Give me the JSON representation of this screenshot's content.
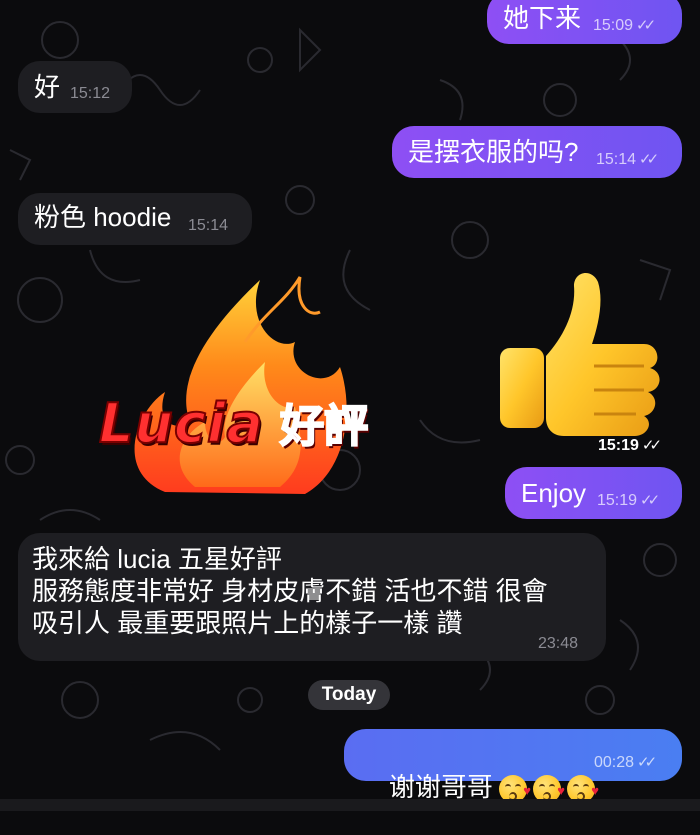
{
  "messages": [
    {
      "text": "她下来",
      "time": "15:09"
    },
    {
      "text": "好",
      "time": "15:12"
    },
    {
      "text": "是摆衣服的吗?",
      "time": "15:14"
    },
    {
      "text": "粉色 hoodie",
      "time": "15:14"
    },
    {
      "text": "15:19"
    },
    {
      "text": "Enjoy",
      "time": "15:19"
    },
    {
      "text": "我來給 lucia 五星好評\n服務態度非常好 身材皮膚不錯 活也不錯 很會\n吸引人 最重要跟照片上的樣子一樣 讚",
      "time": "23:48"
    },
    {
      "text": "谢谢哥哥",
      "time": "00:28"
    }
  ],
  "sticker": {
    "word": "Lucia",
    "badge": "好評"
  },
  "thumbs_time": "15:19",
  "date_separator": "Today",
  "colors": {
    "outgoing": "#7b52f3",
    "incoming": "#1e1e22",
    "background": "#0b0b0d"
  },
  "icons": [
    "double-check-icon",
    "thumbs-up-icon",
    "fire-sticker-icon",
    "kissing-face-icon"
  ]
}
